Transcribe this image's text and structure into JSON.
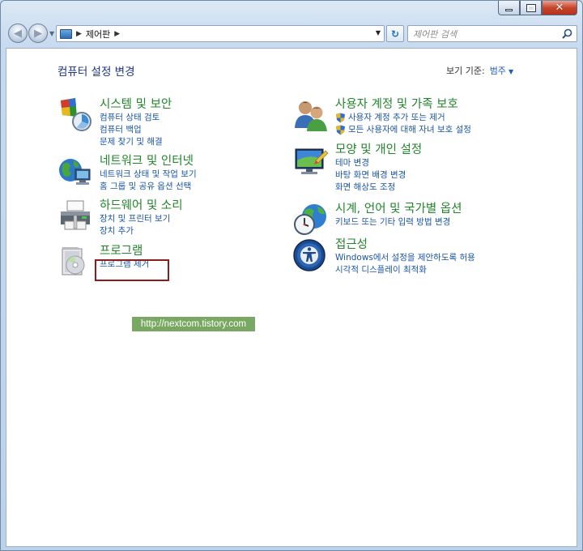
{
  "address_bar": {
    "location": "제어판",
    "search_placeholder": "제어판 검색"
  },
  "header": {
    "title": "컴퓨터 설정 변경",
    "view_by_label": "보기 기준:",
    "view_by_value": "범주"
  },
  "categories": [
    {
      "title": "시스템 및 보안",
      "icon": "system-security-icon",
      "links": [
        "컴퓨터 상태 검토",
        "컴퓨터 백업",
        "문제 찾기 및 해결"
      ]
    },
    {
      "title": "네트워크 및 인터넷",
      "icon": "network-icon",
      "links": [
        "네트워크 상태 및 작업 보기",
        "홈 그룹 및 공유 옵션 선택"
      ]
    },
    {
      "title": "하드웨어 및 소리",
      "icon": "printer-icon",
      "links": [
        "장치 및 프린터 보기",
        "장치 추가"
      ]
    },
    {
      "title": "프로그램",
      "icon": "programs-icon",
      "links": [
        "프로그램 제거"
      ]
    },
    {
      "title": "사용자 계정 및 가족 보호",
      "icon": "users-icon",
      "links": [
        "사용자 계정 추가 또는 제거",
        "모든 사용자에 대해 자녀 보호 설정"
      ]
    },
    {
      "title": "모양 및 개인 설정",
      "icon": "display-icon",
      "links": [
        "테마 변경",
        "바탕 화면 배경 변경",
        "화면 해상도 조정"
      ]
    },
    {
      "title": "시계, 언어 및 국가별 옵션",
      "icon": "clock-globe-icon",
      "links": [
        "키보드 또는 기타 입력 방법 변경"
      ]
    },
    {
      "title": "접근성",
      "icon": "accessibility-icon",
      "links": [
        "Windows에서 설정을 제안하도록 허용",
        "시각적 디스플레이 최적화"
      ]
    }
  ],
  "watermark": "http://nextcom.tistory.com",
  "colors": {
    "category_title": "#21862a",
    "link": "#1a55a8",
    "highlight_box": "#8b1c1c"
  }
}
